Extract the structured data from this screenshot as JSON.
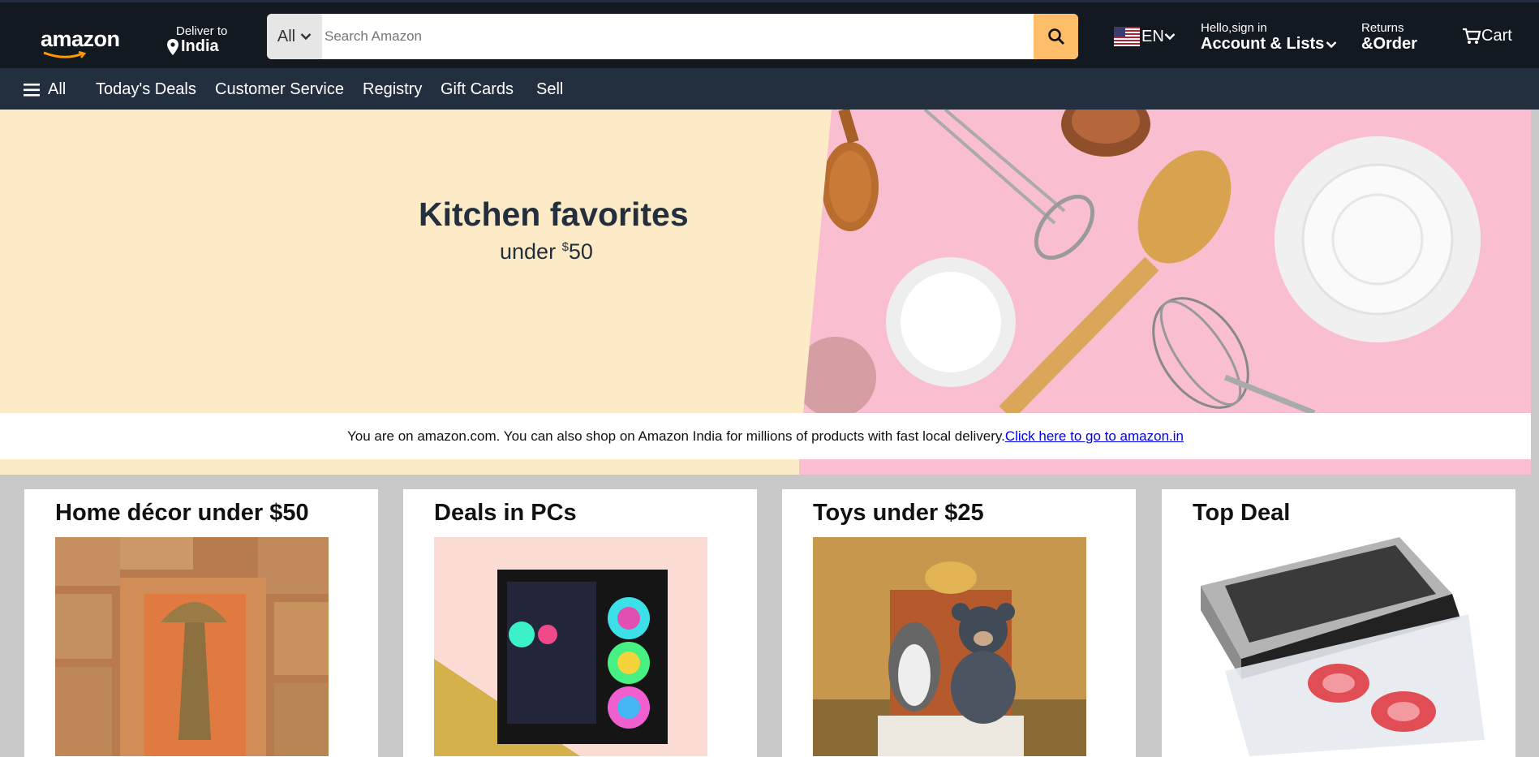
{
  "header": {
    "logo": "amazon",
    "deliver_label": "Deliver to",
    "deliver_location": "India",
    "search_category": "All",
    "search_placeholder": "Search Amazon",
    "language": "EN",
    "account_line1": "Hello,sign in",
    "account_line2": "Account & Lists",
    "returns_line1": "Returns",
    "returns_line2": "&Order",
    "cart_label": "Cart"
  },
  "nav": {
    "menu_label": "All",
    "items": [
      "Today's Deals",
      "Customer Service",
      "Registry",
      "Gift Cards",
      "Sell"
    ]
  },
  "hero": {
    "title": "Kitchen favorites",
    "subtitle_prefix": "under ",
    "subtitle_currency": "$",
    "subtitle_amount": "50"
  },
  "notice": {
    "text": "You are on amazon.com. You can also shop on Amazon India for millions of products with fast local delivery.",
    "link": "Click here to go to amazon.in"
  },
  "cards": [
    {
      "title": "Home décor under $50"
    },
    {
      "title": "Deals in PCs"
    },
    {
      "title": "Toys under $25"
    },
    {
      "title": "Top Deal"
    }
  ],
  "colors": {
    "header_bg": "#131921",
    "nav_bg": "#232f3e",
    "search_button": "#febd69",
    "hero_bg": "#fdebc7",
    "hero_image_bg": "#f9bfd1",
    "link": "#0000ee"
  },
  "icons": [
    "location-pin-icon",
    "chevron-down-icon",
    "search-icon",
    "us-flag-icon",
    "cart-icon",
    "hamburger-menu-icon"
  ]
}
